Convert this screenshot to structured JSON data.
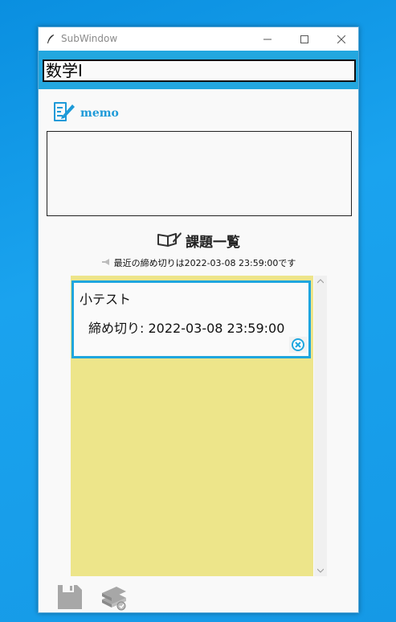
{
  "window": {
    "title": "SubWindow"
  },
  "subject": {
    "name": "数学Ⅰ"
  },
  "memo": {
    "label": "memo",
    "content": ""
  },
  "tasks": {
    "heading": "課題一覧",
    "nearest_deadline_note": "最近の締め切りは2022-03-08 23:59:00です",
    "items": [
      {
        "name": "小テスト",
        "due_text": "締め切り: 2022-03-08 23:59:00"
      }
    ]
  },
  "icons": {
    "app": "feather-icon",
    "memo": "memo-pen-icon",
    "heading": "open-book-pen-icon",
    "note": "megaphone-icon",
    "delete": "close-circle-icon",
    "save": "floppy-disk-icon",
    "books": "books-icon"
  },
  "colors": {
    "accent": "#23a7df",
    "task_area": "#ede58a",
    "memo_text": "#1d9ad8"
  }
}
